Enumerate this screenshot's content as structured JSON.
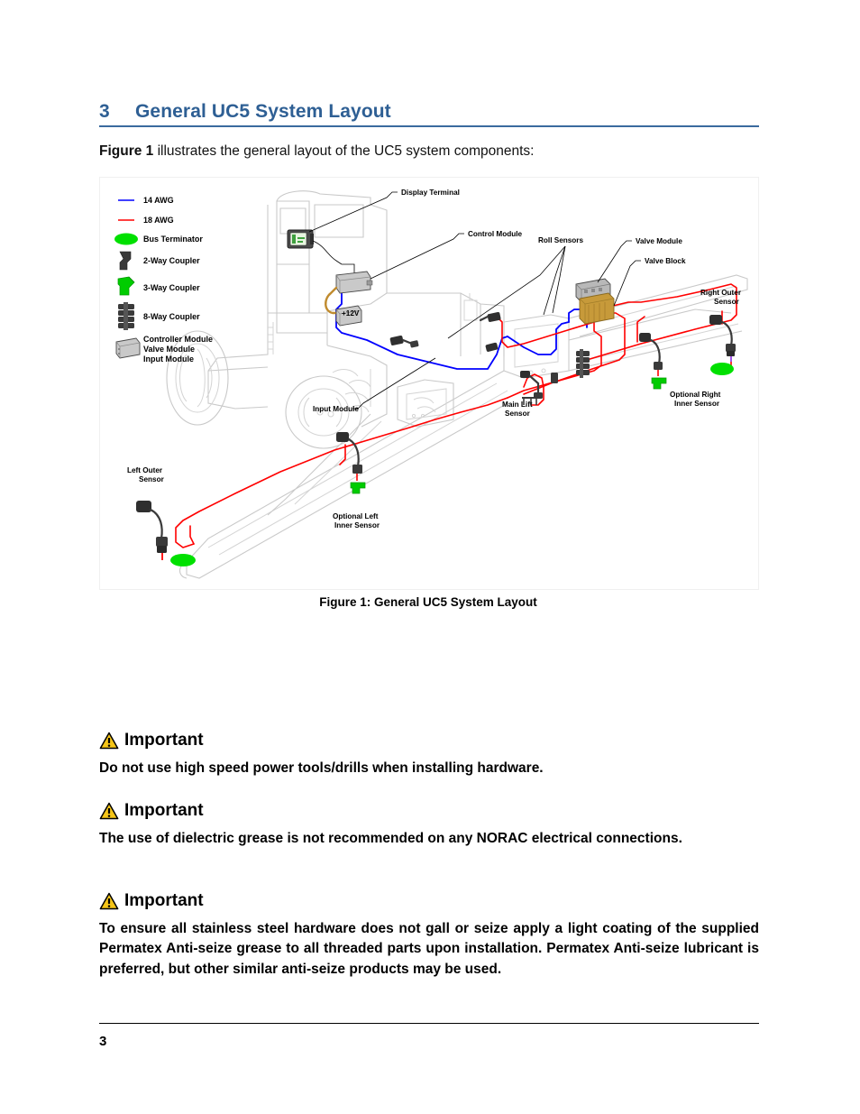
{
  "heading": {
    "number": "3",
    "title": "General UC5 System Layout"
  },
  "intro": {
    "bold_lead": "Figure 1",
    "rest": " illustrates the general layout of the UC5 system components:"
  },
  "figure": {
    "caption": "Figure 1: General UC5 System Layout",
    "legend": [
      {
        "label": "14 AWG",
        "type": "line",
        "color": "#0000FF"
      },
      {
        "label": "18 AWG",
        "type": "line",
        "color": "#FF0000"
      },
      {
        "label": "Bus Terminator",
        "type": "terminator",
        "color": "#00E000"
      },
      {
        "label": "2-Way Coupler",
        "type": "coupler2",
        "color": "#3A3A3A"
      },
      {
        "label": "3-Way Coupler",
        "type": "coupler3",
        "color": "#00CC00"
      },
      {
        "label": "8-Way Coupler",
        "type": "coupler8",
        "color": "#3A3A3A"
      },
      {
        "label": "Controller Module",
        "type": "module",
        "color": "#C8C8C8"
      },
      {
        "label": "Valve Module",
        "type": "module-cont",
        "color": "#C8C8C8"
      },
      {
        "label": "Input Module",
        "type": "module-cont",
        "color": "#C8C8C8"
      }
    ],
    "callouts": {
      "display_terminal": "Display Terminal",
      "control_module": "Control Module",
      "roll_sensors": "Roll Sensors",
      "valve_module": "Valve Module",
      "valve_block": "Valve Block",
      "power": "+12V",
      "right_outer_sensor_l1": "Right Outer",
      "right_outer_sensor_l2": "Sensor",
      "optional_right_inner_l1": "Optional Right",
      "optional_right_inner_l2": "Inner Sensor",
      "input_module": "Input Module",
      "main_lift_sensor_l1": "Main Lift",
      "main_lift_sensor_l2": "Sensor",
      "left_outer_sensor_l1": "Left Outer",
      "left_outer_sensor_l2": "Sensor",
      "optional_left_inner_l1": "Optional Left",
      "optional_left_inner_l2": "Inner Sensor"
    }
  },
  "important_blocks": [
    {
      "heading": "Important",
      "icon": "warning-triangle-icon",
      "body": "Do not use high speed power tools/drills when installing hardware."
    },
    {
      "heading": "Important",
      "icon": "warning-triangle-icon",
      "body": "The use of dielectric grease is not recommended on any NORAC electrical connections."
    },
    {
      "heading": "Important",
      "icon": "warning-triangle-icon",
      "body": "To ensure all stainless steel hardware does not gall or seize apply a light coating of the supplied Permatex Anti-seize grease to all threaded parts upon installation. Permatex Anti-seize lubricant is preferred, but other similar anti-seize products may be used."
    }
  ],
  "footer": {
    "page_number": "3"
  },
  "colors": {
    "heading_blue": "#2E5F94",
    "wire_14awg": "#0000FF",
    "wire_18awg": "#FF0000",
    "connector_green": "#00E000",
    "warning_yellow": "#F5C518",
    "machine_outline": "#C9C9C9",
    "valve_block_gold": "#C79A3A"
  }
}
